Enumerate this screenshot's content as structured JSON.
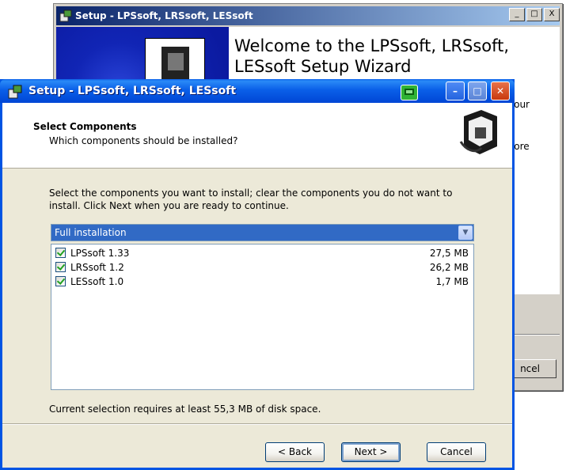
{
  "background_window": {
    "title": "Setup - LPSsoft, LRSsoft, LESsoft",
    "controls": [
      "_",
      "□",
      "X"
    ],
    "heading": "Welcome to the LPSsoft, LRSsoft, LESsoft Setup Wizard",
    "partial_text_1": "your",
    "partial_text_2": "fore",
    "partial_cancel": "ncel"
  },
  "window": {
    "title": "Setup - LPSsoft, LRSsoft, LESsoft",
    "minimize": "–",
    "maximize": "□",
    "close": "✕"
  },
  "header": {
    "title": "Select Components",
    "subtitle": "Which components should be installed?"
  },
  "intro": "Select the components you want to install; clear the components you do not want to install. Click Next when you are ready to continue.",
  "setup_type": {
    "selected": "Full installation"
  },
  "components": [
    {
      "name": "LPSsoft 1.33",
      "size": "27,5 MB",
      "checked": true
    },
    {
      "name": "LRSsoft 1.2",
      "size": "26,2 MB",
      "checked": true
    },
    {
      "name": "LESsoft 1.0",
      "size": "1,7 MB",
      "checked": true
    }
  ],
  "status": "Current selection requires at least 55,3 MB of disk space.",
  "buttons": {
    "back": "< Back",
    "next": "Next >",
    "cancel": "Cancel"
  }
}
